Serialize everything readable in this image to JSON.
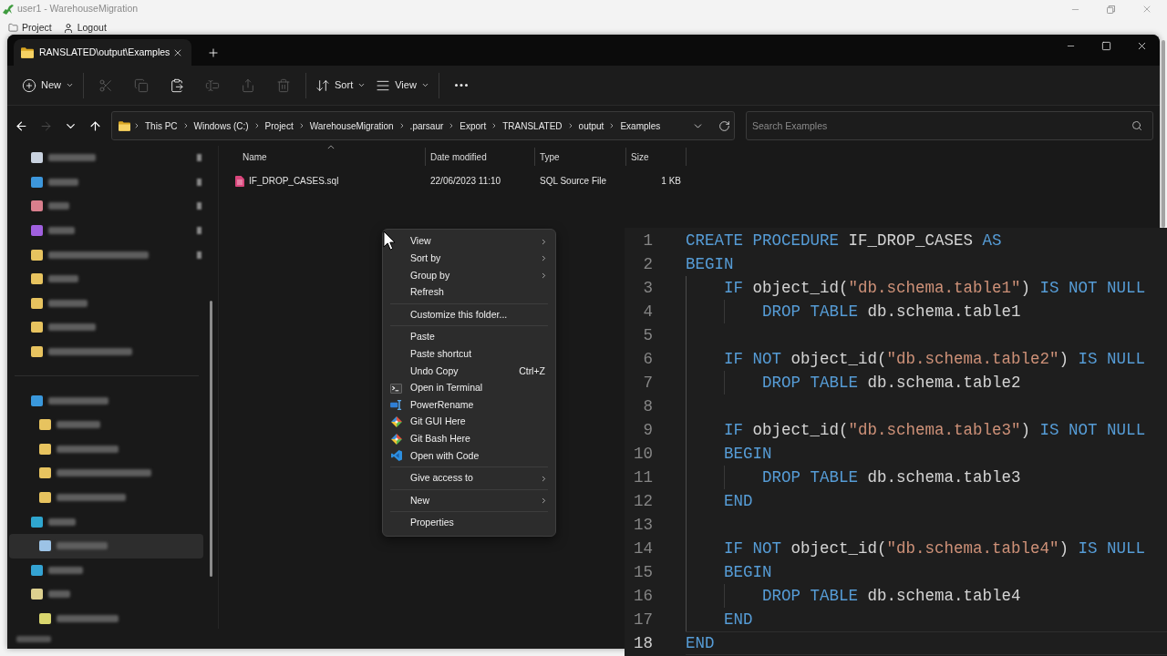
{
  "app": {
    "title": "user1 - WarehouseMigration",
    "menu": [
      {
        "kind": "folder",
        "label": "Project"
      },
      {
        "kind": "user",
        "label": "Logout"
      }
    ]
  },
  "explorer": {
    "tabs": [
      {
        "label": "RANSLATED\\output\\Examples",
        "selected": true
      }
    ],
    "toolbar": {
      "groups": [
        [
          {
            "kind": "new",
            "label": "New",
            "dropdown": true,
            "disabled": false
          }
        ],
        [
          {
            "kind": "cut",
            "dropdown": false,
            "disabled": true
          },
          {
            "kind": "copy",
            "dropdown": false,
            "disabled": true
          },
          {
            "kind": "paste",
            "dropdown": false,
            "disabled": false
          },
          {
            "kind": "rename",
            "dropdown": false,
            "disabled": true
          },
          {
            "kind": "share",
            "dropdown": false,
            "disabled": true
          },
          {
            "kind": "delete",
            "dropdown": false,
            "disabled": true
          }
        ],
        [
          {
            "kind": "sort",
            "label": "Sort",
            "dropdown": true,
            "disabled": false
          },
          {
            "kind": "view",
            "label": "View",
            "dropdown": true,
            "disabled": false
          }
        ],
        [
          {
            "kind": "more",
            "dropdown": false,
            "disabled": false
          }
        ]
      ]
    },
    "nav_buttons": [
      {
        "kind": "back",
        "disabled": false
      },
      {
        "kind": "forward",
        "disabled": true
      },
      {
        "kind": "recent",
        "disabled": false
      },
      {
        "kind": "up",
        "disabled": false
      }
    ],
    "address_bar": {
      "segments": [
        "This PC",
        "Windows (C:)",
        "Project",
        "WarehouseMigration",
        ".parsaur",
        "Export",
        "TRANSLATED",
        "output",
        "Examples"
      ]
    },
    "search": {
      "placeholder": "Search Examples"
    },
    "nav_pane": {
      "quick_access": [
        {
          "color": "#c9d2df",
          "pinned": true,
          "selected": false
        },
        {
          "color": "#3d97dc",
          "pinned": true,
          "selected": false
        },
        {
          "color": "#d97f8d",
          "pinned": true,
          "selected": false
        },
        {
          "color": "#a060df",
          "pinned": true,
          "selected": false
        },
        {
          "color": "#e7c35f",
          "pinned": true,
          "selected": false
        },
        {
          "color": "#e7c35f",
          "pinned": false,
          "selected": false
        },
        {
          "color": "#e7c35f",
          "pinned": false,
          "selected": false
        },
        {
          "color": "#e7c35f",
          "pinned": false,
          "selected": false
        },
        {
          "color": "#e7c35f",
          "pinned": false,
          "selected": false
        }
      ],
      "tree": [
        {
          "color": "#3a98dc",
          "selected": false,
          "children": [
            {
              "color": "#e7c35f",
              "selected": false
            },
            {
              "color": "#e7c35f",
              "selected": false
            },
            {
              "color": "#e7c35f",
              "selected": false
            },
            {
              "color": "#e7c35f",
              "selected": false
            }
          ]
        },
        {
          "color": "#2fa6cf",
          "selected": false,
          "children": [
            {
              "color": "#9cc3e6",
              "selected": true
            }
          ]
        },
        {
          "color": "#34a3d3",
          "selected": false
        },
        {
          "color": "#ddd08f",
          "selected": false,
          "children": [
            {
              "color": "#d9d66e",
              "selected": false
            }
          ]
        }
      ]
    },
    "file_list": {
      "columns": [
        {
          "label": "Name",
          "sorted": true
        },
        {
          "label": "Date modified",
          "sorted": false
        },
        {
          "label": "Type",
          "sorted": false
        },
        {
          "label": "Size",
          "sorted": false
        }
      ],
      "rows": [
        {
          "name": "IF_DROP_CASES.sql",
          "date_modified": "22/06/2023 11:10",
          "type": "SQL Source File",
          "size": "1 KB"
        }
      ]
    }
  },
  "context_menu": {
    "groups": [
      [
        {
          "label": "View",
          "kind": "plain",
          "submenu": true
        },
        {
          "label": "Sort by",
          "kind": "plain",
          "submenu": true
        },
        {
          "label": "Group by",
          "kind": "plain",
          "submenu": true
        },
        {
          "label": "Refresh",
          "kind": "plain",
          "submenu": false
        }
      ],
      [
        {
          "label": "Customize this folder...",
          "kind": "plain",
          "submenu": false
        }
      ],
      [
        {
          "label": "Paste",
          "kind": "plain",
          "submenu": false
        },
        {
          "label": "Paste shortcut",
          "kind": "plain",
          "submenu": false
        },
        {
          "label": "Undo Copy",
          "kind": "plain",
          "submenu": false,
          "shortcut": "Ctrl+Z"
        },
        {
          "label": "Open in Terminal",
          "kind": "terminal",
          "submenu": false
        },
        {
          "label": "PowerRename",
          "kind": "rename",
          "submenu": false
        },
        {
          "label": "Git GUI Here",
          "kind": "git",
          "submenu": false
        },
        {
          "label": "Git Bash Here",
          "kind": "git",
          "submenu": false
        },
        {
          "label": "Open with Code",
          "kind": "code",
          "submenu": false
        }
      ],
      [
        {
          "label": "Give access to",
          "kind": "plain",
          "submenu": true
        }
      ],
      [
        {
          "label": "New",
          "kind": "plain",
          "submenu": true
        }
      ],
      [
        {
          "label": "Properties",
          "kind": "plain",
          "submenu": false
        }
      ]
    ]
  },
  "code_editor": {
    "lines": [
      {
        "number": "1",
        "current": false,
        "tokens": [
          {
            "kind": "keyword",
            "text": "CREATE PROCEDURE"
          },
          {
            "kind": "plain",
            "text": " IF_DROP_CASES "
          },
          {
            "kind": "keyword",
            "text": "AS"
          }
        ]
      },
      {
        "number": "2",
        "current": false,
        "tokens": [
          {
            "kind": "keyword",
            "text": "BEGIN"
          }
        ]
      },
      {
        "number": "3",
        "current": false,
        "tokens": [
          {
            "kind": "keyword",
            "text": "    IF"
          },
          {
            "kind": "plain",
            "text": " object_id("
          },
          {
            "kind": "string",
            "text": "\"db.schema.table1\""
          },
          {
            "kind": "plain",
            "text": ") "
          },
          {
            "kind": "keyword",
            "text": "IS NOT NULL"
          }
        ]
      },
      {
        "number": "4",
        "current": false,
        "tokens": [
          {
            "kind": "keyword",
            "text": "        DROP TABLE"
          },
          {
            "kind": "plain",
            "text": " db.schema.table1"
          }
        ]
      },
      {
        "number": "5",
        "current": false
      },
      {
        "number": "6",
        "current": false,
        "tokens": [
          {
            "kind": "keyword",
            "text": "    IF NOT"
          },
          {
            "kind": "plain",
            "text": " object_id("
          },
          {
            "kind": "string",
            "text": "\"db.schema.table2\""
          },
          {
            "kind": "plain",
            "text": ") "
          },
          {
            "kind": "keyword",
            "text": "IS NULL"
          }
        ]
      },
      {
        "number": "7",
        "current": false,
        "tokens": [
          {
            "kind": "keyword",
            "text": "        DROP TABLE"
          },
          {
            "kind": "plain",
            "text": " db.schema.table2"
          }
        ]
      },
      {
        "number": "8",
        "current": false
      },
      {
        "number": "9",
        "current": false,
        "tokens": [
          {
            "kind": "keyword",
            "text": "    IF"
          },
          {
            "kind": "plain",
            "text": " object_id("
          },
          {
            "kind": "string",
            "text": "\"db.schema.table3\""
          },
          {
            "kind": "plain",
            "text": ") "
          },
          {
            "kind": "keyword",
            "text": "IS NOT NULL"
          }
        ]
      },
      {
        "number": "10",
        "current": false,
        "tokens": [
          {
            "kind": "keyword",
            "text": "    BEGIN"
          }
        ]
      },
      {
        "number": "11",
        "current": false,
        "tokens": [
          {
            "kind": "keyword",
            "text": "        DROP TABLE"
          },
          {
            "kind": "plain",
            "text": " db.schema.table3"
          }
        ]
      },
      {
        "number": "12",
        "current": false,
        "tokens": [
          {
            "kind": "keyword",
            "text": "    END"
          }
        ]
      },
      {
        "number": "13",
        "current": false
      },
      {
        "number": "14",
        "current": false,
        "tokens": [
          {
            "kind": "keyword",
            "text": "    IF NOT"
          },
          {
            "kind": "plain",
            "text": " object_id("
          },
          {
            "kind": "string",
            "text": "\"db.schema.table4\""
          },
          {
            "kind": "plain",
            "text": ") "
          },
          {
            "kind": "keyword",
            "text": "IS NULL"
          }
        ]
      },
      {
        "number": "15",
        "current": false,
        "tokens": [
          {
            "kind": "keyword",
            "text": "    BEGIN"
          }
        ]
      },
      {
        "number": "16",
        "current": false,
        "tokens": [
          {
            "kind": "keyword",
            "text": "        DROP TABLE"
          },
          {
            "kind": "plain",
            "text": " db.schema.table4"
          }
        ]
      },
      {
        "number": "17",
        "current": false,
        "tokens": [
          {
            "kind": "keyword",
            "text": "    END"
          }
        ]
      },
      {
        "number": "18",
        "current": true,
        "tokens": [
          {
            "kind": "keyword",
            "text": "END"
          }
        ]
      }
    ]
  }
}
